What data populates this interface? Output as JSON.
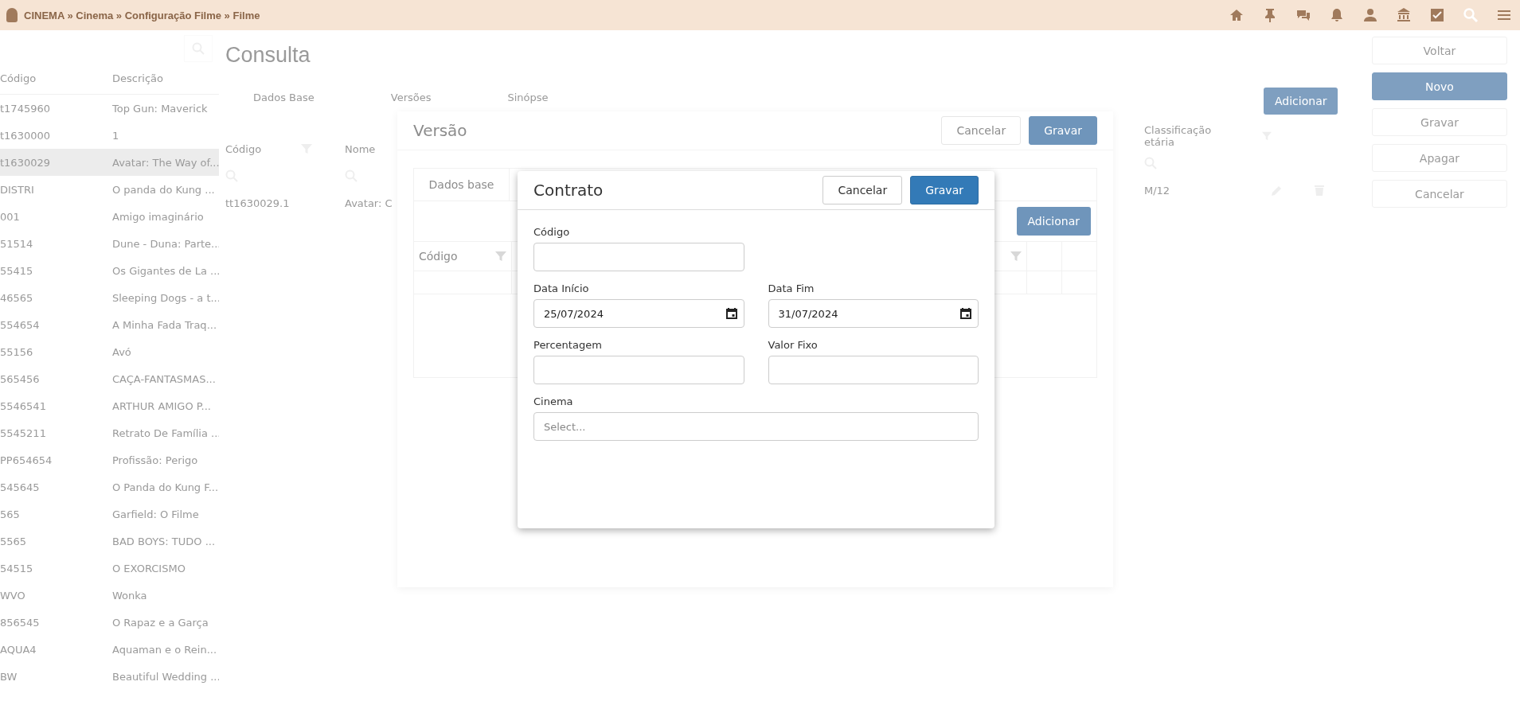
{
  "top_bar": {
    "breadcrumb": "CINEMA » Cinema » Configuração Filme » Filme"
  },
  "film_list": {
    "columns": [
      "Código",
      "Descrição"
    ],
    "rows": [
      {
        "code": "t1745960",
        "description": "Top Gun: Maverick",
        "selected": false
      },
      {
        "code": "t1630000",
        "description": "1",
        "selected": false
      },
      {
        "code": "t1630029",
        "description": "Avatar: The Way of...",
        "selected": true
      },
      {
        "code": "DISTRI",
        "description": "O panda do Kung ...",
        "selected": false
      },
      {
        "code": "001",
        "description": "Amigo imaginário",
        "selected": false
      },
      {
        "code": "51514",
        "description": "Dune - Duna: Parte...",
        "selected": false
      },
      {
        "code": "55415",
        "description": "Os Gigantes de La ...",
        "selected": false
      },
      {
        "code": "46565",
        "description": "Sleeping Dogs - a t...",
        "selected": false
      },
      {
        "code": "554654",
        "description": "A Minha Fada Traq...",
        "selected": false
      },
      {
        "code": "55156",
        "description": "Avó",
        "selected": false
      },
      {
        "code": "565456",
        "description": "CAÇA-FANTASMAS...",
        "selected": false
      },
      {
        "code": "5546541",
        "description": "ARTHUR AMIGO P...",
        "selected": false
      },
      {
        "code": "5545211",
        "description": "Retrato De Família ...",
        "selected": false
      },
      {
        "code": "PP654654",
        "description": "Profissão: Perigo",
        "selected": false
      },
      {
        "code": "545645",
        "description": "O Panda do Kung F...",
        "selected": false
      },
      {
        "code": "565",
        "description": "Garfield: O Filme",
        "selected": false
      },
      {
        "code": "5565",
        "description": "BAD BOYS: TUDO ...",
        "selected": false
      },
      {
        "code": "54515",
        "description": "O EXORCISMO",
        "selected": false
      },
      {
        "code": "WVO",
        "description": "Wonka",
        "selected": false
      },
      {
        "code": "856545",
        "description": "O Rapaz e a Garça",
        "selected": false
      },
      {
        "code": "AQUA4",
        "description": "Aquaman e o Rein...",
        "selected": false
      },
      {
        "code": "BW",
        "description": "Beautiful Wedding ...",
        "selected": false
      }
    ]
  },
  "page": {
    "title": "Consulta",
    "tabs": [
      "Dados Base",
      "Versões",
      "Sinópse"
    ],
    "versions_table": {
      "columns": [
        "Código",
        "Nome"
      ],
      "rows": [
        [
          "tt1630029.1",
          "Avatar: C"
        ]
      ]
    },
    "add_button": "Adicionar",
    "rating_table": {
      "columns": [
        "Classificação etária"
      ],
      "rows": [
        "M/12"
      ]
    }
  },
  "actions": [
    {
      "label": "Voltar",
      "primary": false
    },
    {
      "label": "Novo",
      "primary": true
    },
    {
      "label": "Gravar",
      "primary": false
    },
    {
      "label": "Apagar",
      "primary": false
    },
    {
      "label": "Cancelar",
      "primary": false
    }
  ],
  "version_dialog": {
    "title": "Versão",
    "buttons": [
      {
        "label": "Cancelar",
        "primary": false
      },
      {
        "label": "Gravar",
        "primary": true
      }
    ],
    "tabs": [
      {
        "label": "Dados base",
        "selected": true
      }
    ],
    "add_button": "Adicionar",
    "table": {
      "columns": [
        "Código"
      ]
    }
  },
  "contract_dialog": {
    "title": "Contrato",
    "buttons": [
      {
        "label": "Cancelar",
        "primary": false
      },
      {
        "label": "Gravar",
        "primary": true
      }
    ],
    "rows": [
      [
        {
          "label": "Código",
          "kind": "text"
        }
      ],
      [
        {
          "label": "Data Início",
          "kind": "date",
          "value": "25/07/2024"
        },
        {
          "label": "Data Fim",
          "kind": "date",
          "value": "31/07/2024"
        }
      ],
      [
        {
          "label": "Percentagem",
          "kind": "text"
        },
        {
          "label": "Valor Fixo",
          "kind": "text"
        }
      ],
      [
        {
          "label": "Cinema",
          "kind": "select",
          "placeholder": "Select..."
        }
      ]
    ]
  }
}
